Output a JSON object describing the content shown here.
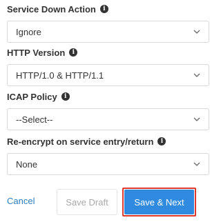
{
  "form": {
    "service_down_action": {
      "label": "Service Down Action",
      "value": "Ignore"
    },
    "http_version": {
      "label": "HTTP Version",
      "value": "HTTP/1.0 & HTTP/1.1"
    },
    "icap_policy": {
      "label": "ICAP Policy",
      "value": "--Select--"
    },
    "reencrypt": {
      "label": "Re-encrypt on service entry/return",
      "value": "None"
    }
  },
  "actions": {
    "cancel_label": "Cancel",
    "save_draft_label": "Save Draft",
    "save_next_label": "Save & Next"
  },
  "icons": {
    "info": "info-icon",
    "chevron": "chevron-down-icon"
  },
  "colors": {
    "primary": "#2f8ae0",
    "link": "#2f7fc1",
    "highlight": "#e0382c"
  }
}
